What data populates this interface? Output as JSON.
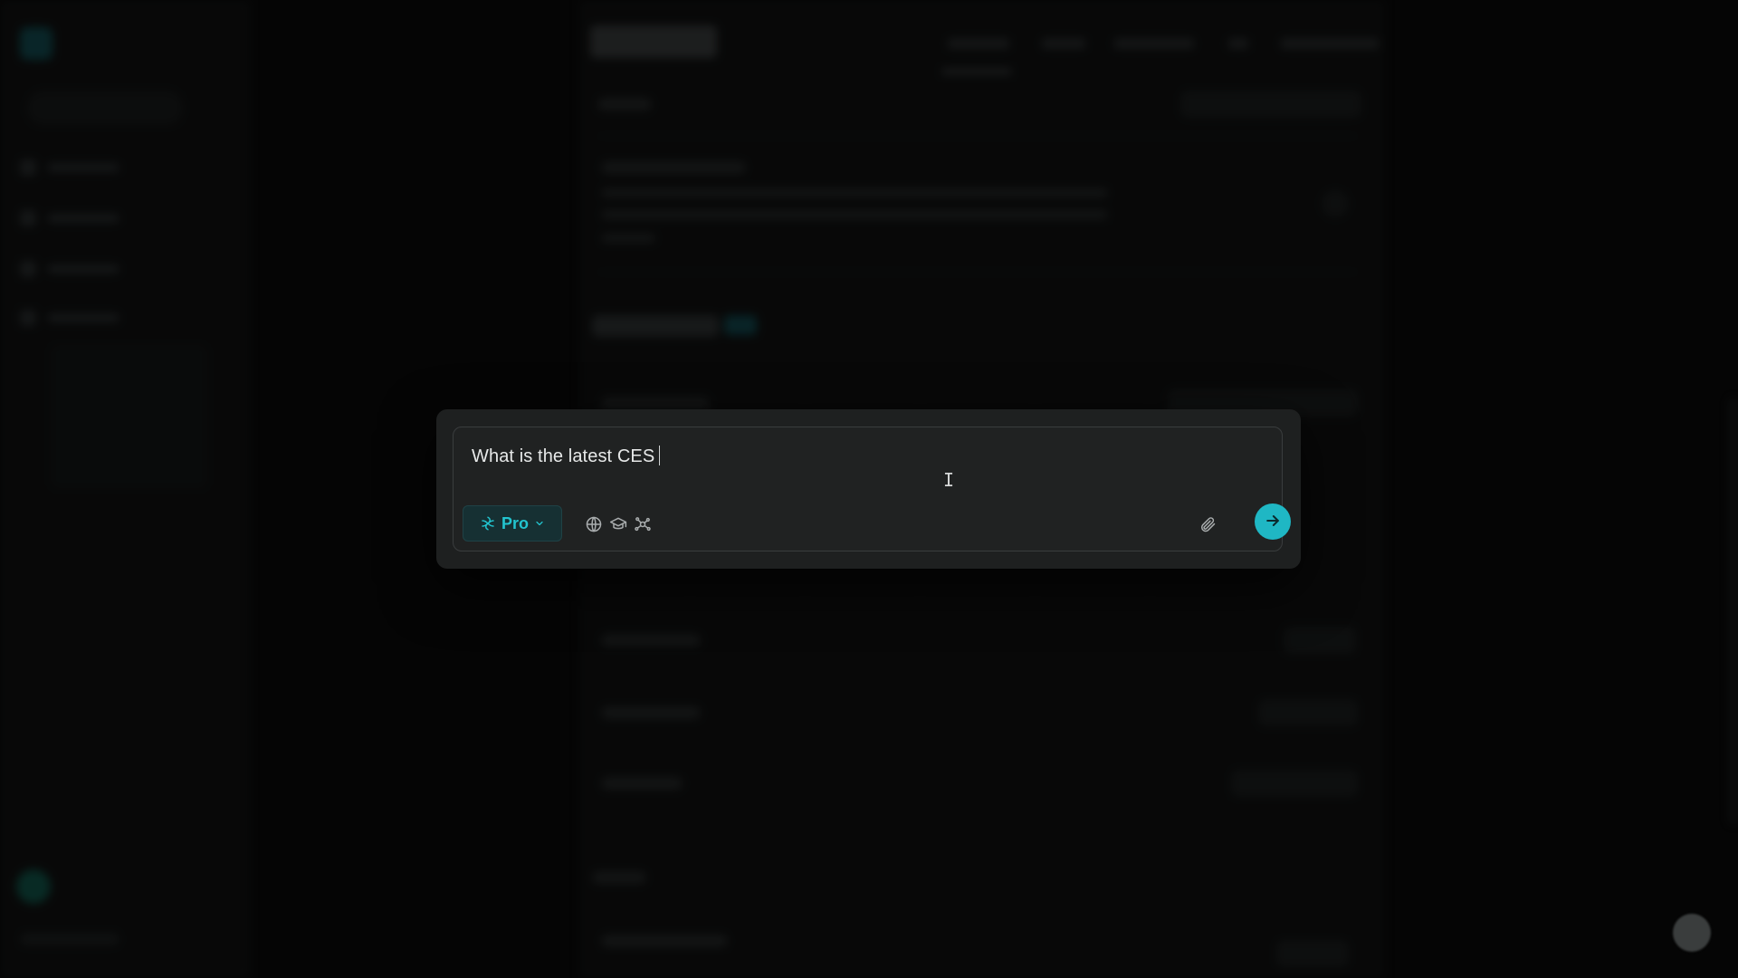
{
  "search_modal": {
    "query_text": "What is the latest CES",
    "mode_label": "Pro",
    "icons": {
      "mode": "pro-spark-icon",
      "mode_dropdown": "chevron-down-icon",
      "focus_web": "globe-icon",
      "focus_academic": "graduation-cap-icon",
      "focus_connectors": "network-nodes-icon",
      "attach": "paperclip-icon",
      "submit": "arrow-right-icon"
    }
  },
  "colors": {
    "accent": "#1fb7c4",
    "modal_bg": "#1e2020",
    "input_border": "#3a3d3e",
    "text_primary": "#e7e9e9"
  }
}
